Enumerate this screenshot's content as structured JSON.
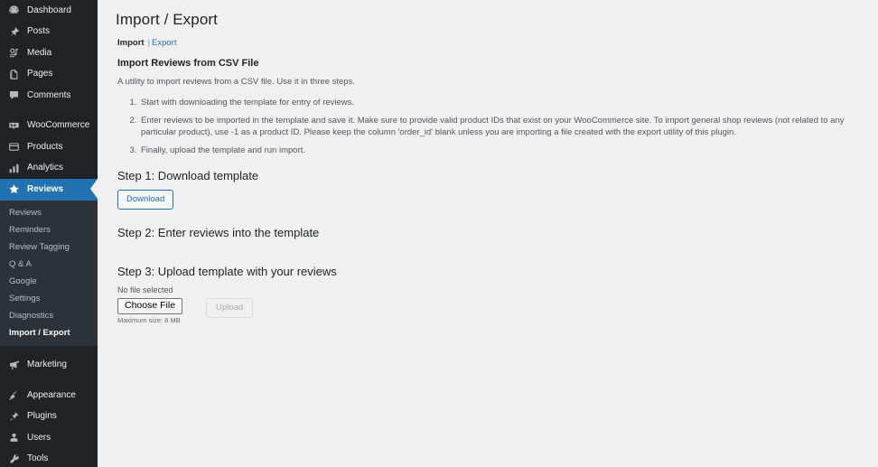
{
  "sidebar": {
    "items": [
      {
        "label": "Dashboard",
        "icon": "dashboard-icon"
      },
      {
        "label": "Posts",
        "icon": "pin-icon"
      },
      {
        "label": "Media",
        "icon": "media-icon"
      },
      {
        "label": "Pages",
        "icon": "pages-icon"
      },
      {
        "label": "Comments",
        "icon": "comments-icon"
      },
      {
        "label": "WooCommerce",
        "icon": "woocommerce-icon"
      },
      {
        "label": "Products",
        "icon": "products-icon"
      },
      {
        "label": "Analytics",
        "icon": "analytics-icon"
      },
      {
        "label": "Reviews",
        "icon": "star-icon"
      },
      {
        "label": "Marketing",
        "icon": "megaphone-icon"
      },
      {
        "label": "Appearance",
        "icon": "paintbrush-icon"
      },
      {
        "label": "Plugins",
        "icon": "plug-icon"
      },
      {
        "label": "Users",
        "icon": "user-icon"
      },
      {
        "label": "Tools",
        "icon": "wrench-icon"
      }
    ],
    "active_item": "Reviews",
    "submenu": [
      {
        "label": "Reviews"
      },
      {
        "label": "Reminders"
      },
      {
        "label": "Review Tagging"
      },
      {
        "label": "Q & A"
      },
      {
        "label": "Google"
      },
      {
        "label": "Settings"
      },
      {
        "label": "Diagnostics"
      },
      {
        "label": "Import / Export"
      }
    ],
    "submenu_current": "Import / Export",
    "colors": {
      "background": "#1d2327",
      "submenu_background": "#2c3338",
      "active_background": "#2271b1"
    }
  },
  "main": {
    "page_title": "Import / Export",
    "subtabs": {
      "current": "Import",
      "separator": "|",
      "link": "Export"
    },
    "section_title": "Import Reviews from CSV File",
    "intro": "A utility to import reviews from a CSV file. Use it in three steps.",
    "steps_list": [
      "Start with downloading the template for entry of reviews.",
      "Enter reviews to be imported in the template and save it. Make sure to provide valid product IDs that exist on your WooCommerce site. To import general shop reviews (not related to any particular product), use -1 as a product ID. Please keep the column 'order_id' blank unless you are importing a file created with the export utility of this plugin.",
      "Finally, upload the template and run import."
    ],
    "step1": {
      "heading": "Step 1: Download template",
      "download_label": "Download"
    },
    "step2": {
      "heading": "Step 2: Enter reviews into the template"
    },
    "step3": {
      "heading": "Step 3: Upload template with your reviews",
      "file_status": "No file selected",
      "choose_file_label": "Choose File",
      "max_size": "Maximum size: 8 MB",
      "upload_label": "Upload"
    },
    "colors": {
      "background": "#f0f0f1",
      "link": "#2271b1",
      "text": "#1d2327"
    }
  }
}
